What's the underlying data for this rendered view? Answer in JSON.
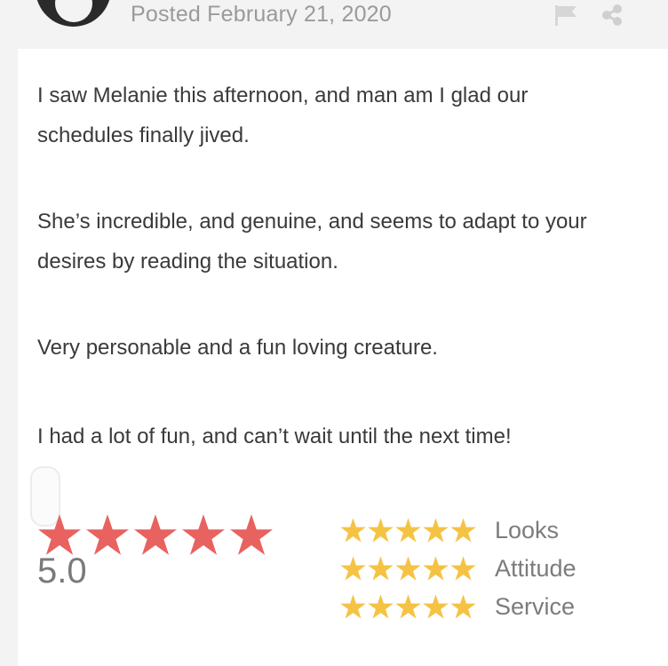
{
  "post": {
    "posted_text": "Posted February 21, 2020"
  },
  "icons": {
    "flag": "flag-icon",
    "share": "share-icon",
    "star": "star-icon"
  },
  "review": {
    "paragraphs": [
      "I saw Melanie this afternoon, and man am I glad our schedules finally jived.",
      "She’s incredible, and genuine, and seems to adapt to your desires by reading the situation.",
      "Very personable and a fun loving creature.",
      "I had a lot of fun, and can’t wait until the next time!"
    ]
  },
  "overall": {
    "stars": 5,
    "score_text": "5.0"
  },
  "categories": [
    {
      "label": "Looks",
      "stars": 5
    },
    {
      "label": "Attitude",
      "stars": 5
    },
    {
      "label": "Service",
      "stars": 5
    }
  ],
  "colors": {
    "overall_star": "#e8625f",
    "category_star": "#f5c344",
    "icon_gray": "#cfcfcf"
  }
}
